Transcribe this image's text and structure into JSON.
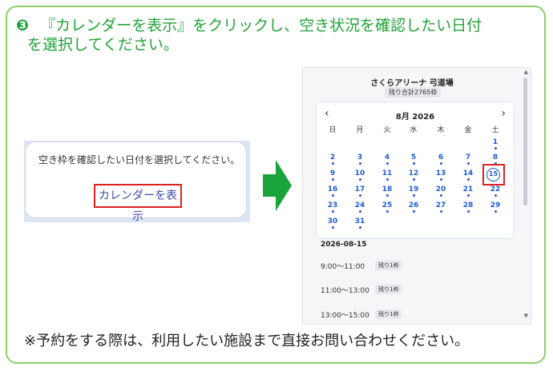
{
  "step": {
    "number": "❸",
    "line1": "『カレンダーを表示』をクリックし、空き状況を確認したい日付",
    "line2": "を選択してください。"
  },
  "left_card": {
    "message": "空き枠を確認したい日付を選択してください。",
    "button_label": "カレンダーを表示"
  },
  "panel": {
    "venue": "さくらアリーナ 弓道場",
    "remaining_total": "残り合計2765枠",
    "prev_icon": "‹",
    "next_icon": "›",
    "month": "8月 2026",
    "weekdays": [
      "日",
      "月",
      "火",
      "水",
      "木",
      "金",
      "土"
    ],
    "days": [
      "1",
      "2",
      "3",
      "4",
      "5",
      "6",
      "7",
      "8",
      "9",
      "10",
      "11",
      "12",
      "13",
      "14",
      "15",
      "16",
      "17",
      "18",
      "19",
      "20",
      "21",
      "22",
      "23",
      "24",
      "25",
      "26",
      "27",
      "28",
      "29",
      "30",
      "31"
    ],
    "selected_day": "15",
    "selected_date": "2026-08-15",
    "slots": [
      {
        "time": "9:00～11:00",
        "remaining": "残り1枠"
      },
      {
        "time": "11:00～13:00",
        "remaining": "残り1枠"
      },
      {
        "time": "13:00～15:00",
        "remaining": "残り1枠"
      }
    ]
  },
  "note": "※予約をする際は、利用したい施設まで直接お問い合わせください。",
  "colors": {
    "green": "#22a23a",
    "border": "#8fcc6a",
    "highlight": "#e02020",
    "calendar_blue": "#1e5bd8"
  }
}
